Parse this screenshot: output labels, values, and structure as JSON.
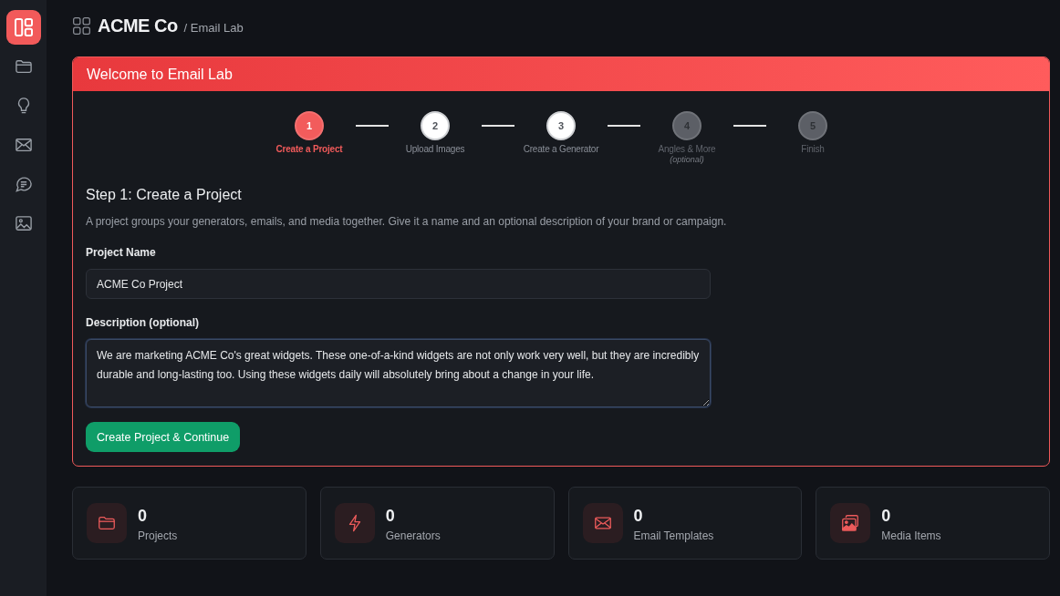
{
  "sidebar": {
    "items": [
      {
        "selected": true
      },
      {
        "selected": false
      },
      {
        "selected": false
      },
      {
        "selected": false
      },
      {
        "selected": false
      },
      {
        "selected": false
      }
    ]
  },
  "header": {
    "title": "ACME Co",
    "breadcrumb": "/ Email Lab"
  },
  "card": {
    "title": "Welcome to Email Lab",
    "steps": [
      {
        "number": "1",
        "label": "Create a Project",
        "selected": true,
        "disabled": false
      },
      {
        "number": "2",
        "label": "Upload Images",
        "selected": false,
        "disabled": false
      },
      {
        "number": "3",
        "label": "Create a Generator",
        "selected": false,
        "disabled": false
      },
      {
        "number": "4",
        "label": "Angles & More",
        "note": "(optional)",
        "selected": false,
        "disabled": true
      },
      {
        "number": "5",
        "label": "Finish",
        "selected": false,
        "disabled": true
      }
    ],
    "heading": "Step 1: Create a Project",
    "intro": "A project groups your generators, emails, and media together. Give it a name and an optional description of your brand or campaign.",
    "fields": [
      {
        "kind": "input",
        "label": "Project Name",
        "value": "ACME Co Project",
        "focused": false
      },
      {
        "kind": "textarea",
        "label": "Description (optional)",
        "value": "We are marketing ACME Co's great widgets. These one-of-a-kind widgets are not only work very well, but they are incredibly durable and long-lasting too. Using these widgets daily will absolutely bring about a change in your life.",
        "focused": true
      }
    ],
    "button": "Create Project & Continue"
  },
  "stats": [
    {
      "value": "0",
      "label": "Projects"
    },
    {
      "value": "0",
      "label": "Generators"
    },
    {
      "value": "0",
      "label": "Email Templates"
    },
    {
      "value": "0",
      "label": "Media Items"
    }
  ]
}
